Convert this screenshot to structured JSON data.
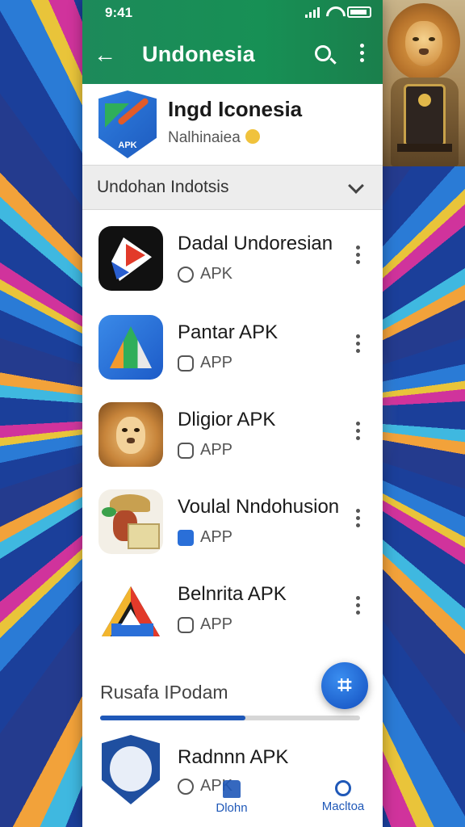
{
  "status_bar": {
    "time": "9:41"
  },
  "app_bar": {
    "title": "Undonesia",
    "back_icon": "arrow-left-icon",
    "search_icon": "search-icon",
    "more_icon": "more-vert-icon"
  },
  "header": {
    "title": "Ingd Iconesia",
    "subtitle": "Nalhinaiea",
    "icon_label": "APK"
  },
  "section": {
    "label": "Undohan Indotsis"
  },
  "apps": [
    {
      "name": "Dadal Undoresian",
      "type": "APK",
      "meta_icon": "search-badge-icon"
    },
    {
      "name": "Pantar APK",
      "type": "APP",
      "meta_icon": "face-badge-icon"
    },
    {
      "name": "Dligior APK",
      "type": "APP",
      "meta_icon": "phone-badge-icon"
    },
    {
      "name": "Voulal Nndohusion",
      "type": "APP",
      "meta_icon": "blue-badge-icon"
    },
    {
      "name": "Belnrita APK",
      "type": "APP",
      "meta_icon": "phone-badge-icon"
    }
  ],
  "section2": {
    "label": "Rusafa IPodam",
    "progress": 0.56
  },
  "last_app": {
    "name": "Radnnn APK",
    "type": "APK"
  },
  "fab": {
    "symbol": "⌗"
  },
  "bottom_nav": [
    {
      "label": "Dlohn",
      "icon": "home-icon"
    },
    {
      "label": "Macltoa",
      "icon": "profile-icon"
    }
  ],
  "colors": {
    "app_bar": "#1d8a5a",
    "accent": "#1f58b8",
    "section_bg": "#ededed"
  }
}
